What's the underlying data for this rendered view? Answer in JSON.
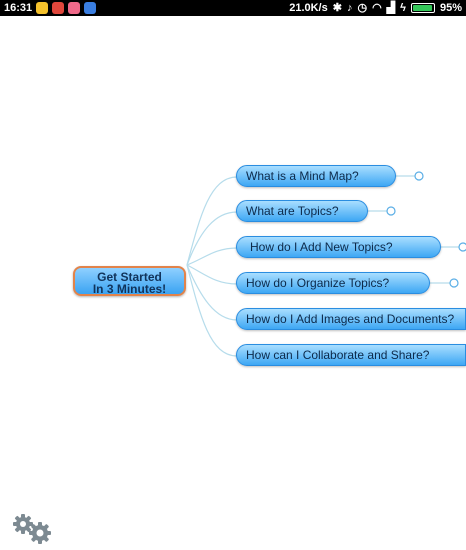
{
  "status_bar": {
    "time": "16:31",
    "net_speed": "21.0K/s",
    "battery_percent": "95%",
    "battery_level": 0.95,
    "left_icons": [
      "weibo-icon",
      "app-icon",
      "app-icon",
      "app-icon"
    ],
    "right_icons": [
      "bluetooth-icon",
      "silent-icon",
      "alarm-icon",
      "wifi-icon",
      "signal-icon",
      "charging-icon"
    ]
  },
  "mind_map": {
    "root": {
      "line1": "Get Started",
      "line2": "In 3 Minutes!"
    },
    "topics": [
      {
        "label": "What is a Mind Map?"
      },
      {
        "label": "What are Topics?"
      },
      {
        "label": "How do I Add New Topics?"
      },
      {
        "label": "How do I Organize Topics?"
      },
      {
        "label": "How do I Add Images and Documents?"
      },
      {
        "label": "How can I Collaborate and Share?"
      }
    ]
  },
  "toolbar": {
    "settings_icon": "gears-icon"
  },
  "colors": {
    "topic_fill_top": "#a9deff",
    "topic_fill_bottom": "#3ea7f4",
    "root_border": "#e2834a",
    "connector": "#b6dceb"
  }
}
